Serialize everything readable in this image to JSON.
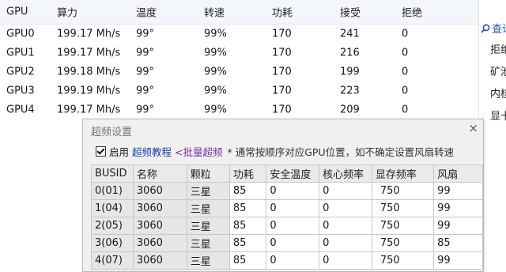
{
  "gpu_table": {
    "headers": [
      "GPU",
      "算力",
      "温度",
      "转速",
      "功耗",
      "接受",
      "拒绝"
    ],
    "rows": [
      [
        "GPU0",
        "199.17 Mh/s",
        "99°",
        "99%",
        "170",
        "241",
        "0"
      ],
      [
        "GPU1",
        "199.17 Mh/s",
        "99°",
        "99%",
        "170",
        "216",
        "0"
      ],
      [
        "GPU2",
        "199.18 Mh/s",
        "99°",
        "99%",
        "170",
        "199",
        "0"
      ],
      [
        "GPU3",
        "199.19 Mh/s",
        "99°",
        "99%",
        "170",
        "223",
        "0"
      ],
      [
        "GPU4",
        "199.17 Mh/s",
        "99°",
        "99%",
        "170",
        "209",
        "0"
      ]
    ]
  },
  "side_panel": {
    "link_label": "查询",
    "items": [
      "拒绝",
      "矿池",
      "内核",
      "显卡"
    ]
  },
  "dialog": {
    "title": "超频设置",
    "close_glyph": "×",
    "enable_label": "启用",
    "tutorial_link": "超频教程",
    "batch_link": "<批量超频",
    "note": "* 通常按顺序对应GPU位置，如不确定设置风扇转速",
    "table": {
      "headers": [
        "BUSID",
        "名称",
        "颗粒",
        "功耗",
        "安全温度",
        "核心频率",
        "显存频率",
        "风扇"
      ],
      "rows": [
        [
          "0(01)",
          "3060",
          "三星",
          "85",
          "0",
          "0",
          "750",
          "99"
        ],
        [
          "1(04)",
          "3060",
          "三星",
          "85",
          "0",
          "0",
          "750",
          "99"
        ],
        [
          "2(05)",
          "3060",
          "三星",
          "85",
          "0",
          "0",
          "750",
          "99"
        ],
        [
          "3(06)",
          "3060",
          "三星",
          "85",
          "0",
          "0",
          "750",
          "85"
        ],
        [
          "4(07)",
          "3060",
          "三星",
          "85",
          "0",
          "0",
          "750",
          "99"
        ]
      ]
    }
  }
}
